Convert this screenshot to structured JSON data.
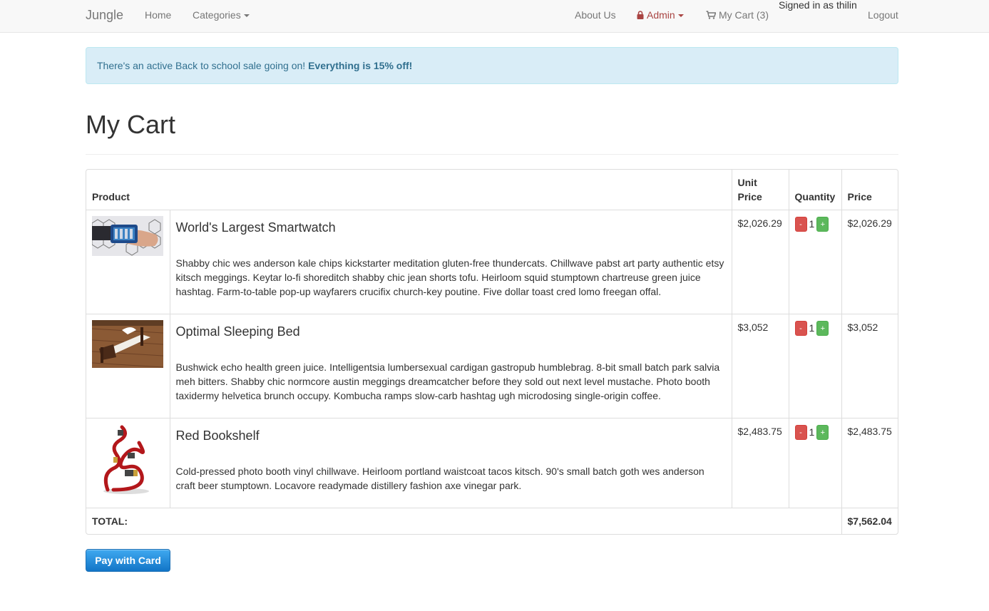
{
  "navbar": {
    "brand": "Jungle",
    "home": "Home",
    "categories": "Categories",
    "about": "About Us",
    "admin": "Admin",
    "cart": "My Cart (3)",
    "signed_in": "Signed in as thilin",
    "logout": "Logout"
  },
  "alert": {
    "text": "There's an active Back to school sale going on!",
    "emphasis": "Everything is 15% off!"
  },
  "page": {
    "title": "My Cart"
  },
  "table": {
    "headers": {
      "product": "Product",
      "unit_price": "Unit Price",
      "quantity": "Quantity",
      "price": "Price"
    },
    "items": [
      {
        "name": "World's Largest Smartwatch",
        "description": "Shabby chic wes anderson kale chips kickstarter meditation gluten-free thundercats. Chillwave pabst art party authentic etsy kitsch meggings. Keytar lo-fi shoreditch shabby chic jean shorts tofu. Heirloom squid stumptown chartreuse green juice hashtag. Farm-to-table pop-up wayfarers crucifix church-key poutine. Five dollar toast cred lomo freegan offal.",
        "unit_price": "$2,026.29",
        "quantity": "1",
        "price": "$2,026.29"
      },
      {
        "name": "Optimal Sleeping Bed",
        "description": "Bushwick echo health green juice. Intelligentsia lumbersexual cardigan gastropub humblebrag. 8-bit small batch park salvia meh bitters. Shabby chic normcore austin meggings dreamcatcher before they sold out next level mustache. Photo booth taxidermy helvetica brunch occupy. Kombucha ramps slow-carb hashtag ugh microdosing single-origin coffee.",
        "unit_price": "$3,052",
        "quantity": "1",
        "price": "$3,052"
      },
      {
        "name": "Red Bookshelf",
        "description": "Cold-pressed photo booth vinyl chillwave. Heirloom portland waistcoat tacos kitsch. 90's small batch goth wes anderson craft beer stumptown. Locavore readymade distillery fashion axe vinegar park.",
        "unit_price": "$2,483.75",
        "quantity": "1",
        "price": "$2,483.75"
      }
    ],
    "qty_minus": "-",
    "qty_plus": "+",
    "total_label": "TOTAL:",
    "total_value": "$7,562.04"
  },
  "pay_button": "Pay with Card",
  "colors": {
    "alert_bg": "#d9edf7",
    "alert_text": "#31708f",
    "admin": "#a94442",
    "minus": "#d9534f",
    "plus": "#5cb85c",
    "pay": "#1a82d6"
  },
  "icons": [
    "lock-icon",
    "shopping-cart-icon",
    "caret-down-icon"
  ]
}
